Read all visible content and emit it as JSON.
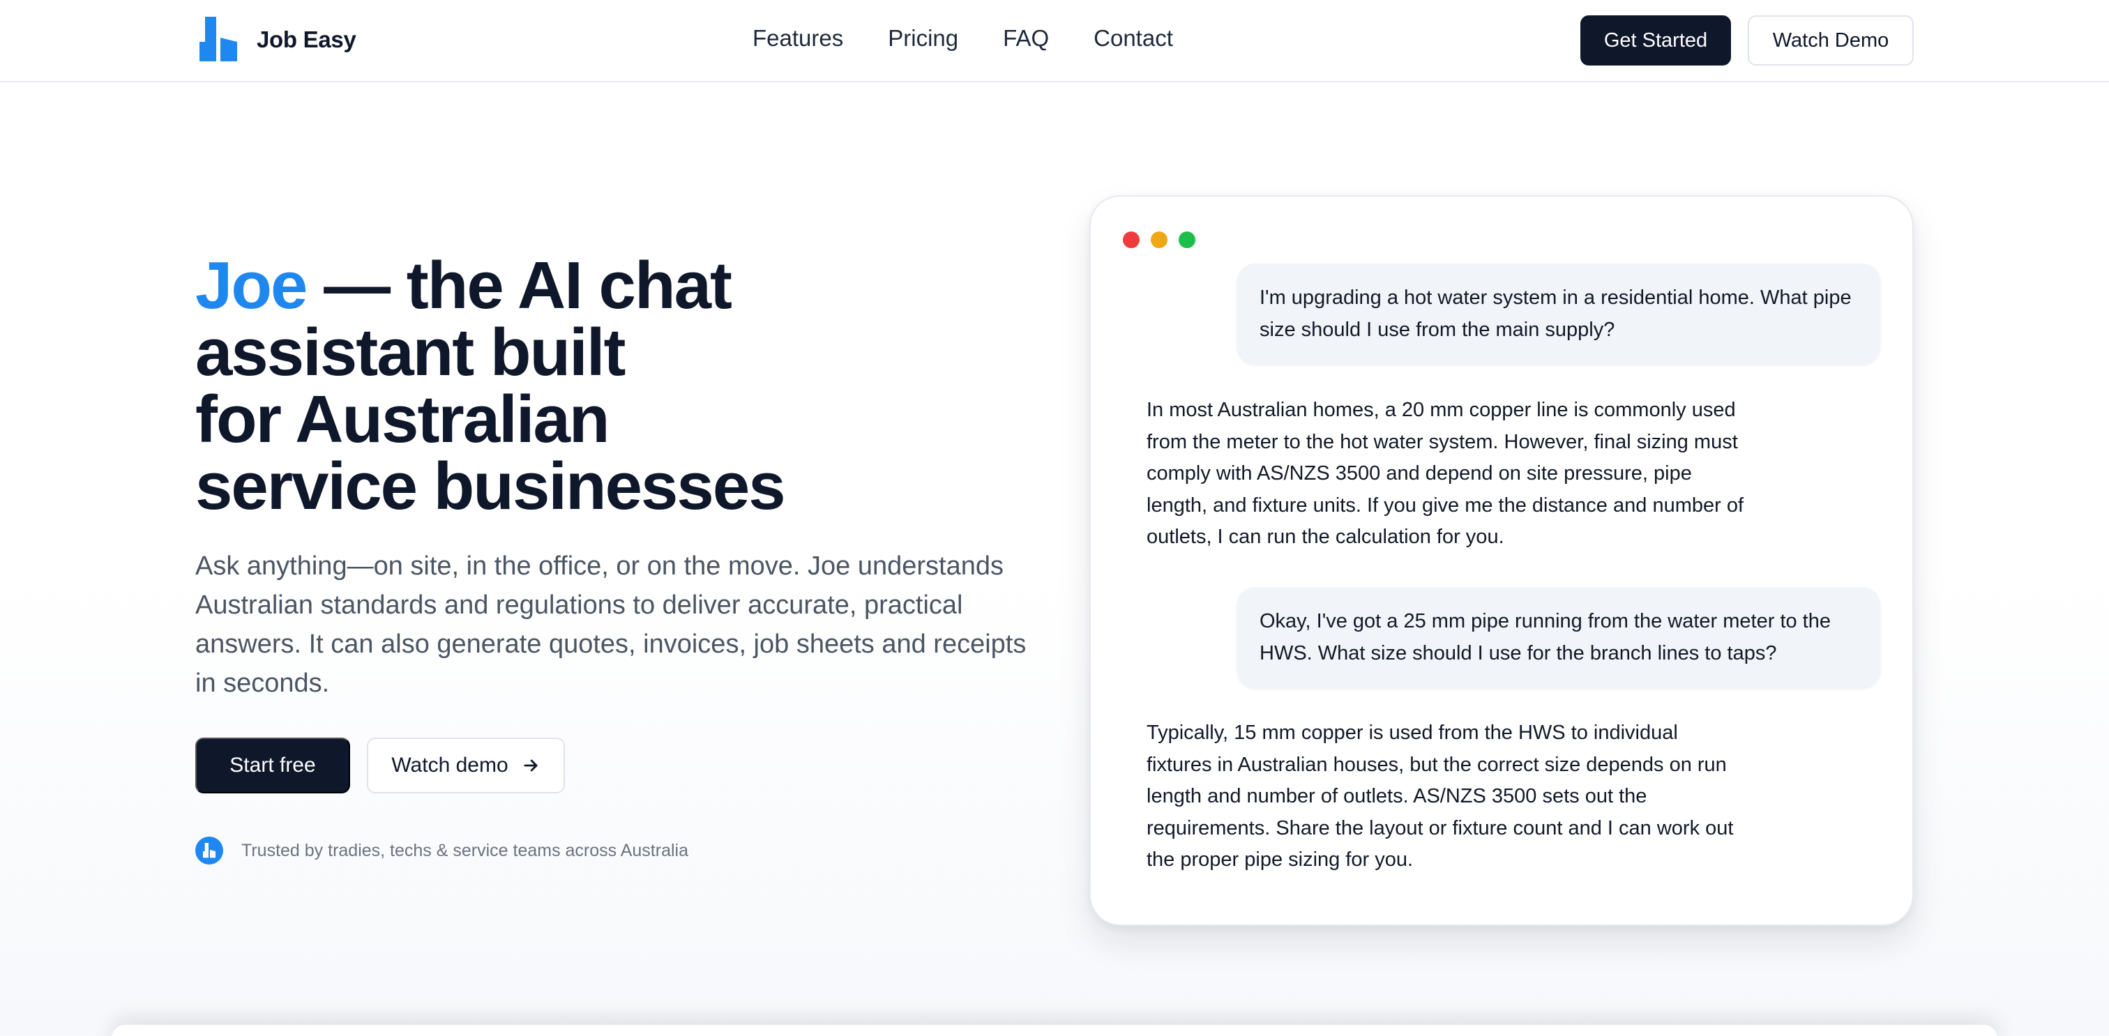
{
  "brand": {
    "name": "Job Easy",
    "accent": "#1e88f0",
    "dark": "#0f172a"
  },
  "nav": {
    "links": [
      "Features",
      "Pricing",
      "FAQ",
      "Contact"
    ],
    "primary_cta": "Get Started",
    "secondary_cta": "Watch Demo"
  },
  "hero": {
    "title_accent": "Joe",
    "title_rest": " — the AI chat",
    "title_line2": "assistant built",
    "title_line3": "for Australian",
    "title_line4": "service businesses",
    "subtitle": "Ask anything—on site, in the office, or on the move. Joe understands Australian standards and regulations to deliver accurate, practical answers. It can also generate quotes, invoices, job sheets and receipts in seconds.",
    "primary_button": "Start free",
    "secondary_button": "Watch demo",
    "trust_text": "Trusted by tradies, techs & service teams across Australia"
  },
  "chat": {
    "window_dots": [
      "#ef3b3b",
      "#f0a716",
      "#1dbf4a"
    ],
    "messages": [
      {
        "role": "user",
        "text": "I'm upgrading a hot water system in a residential home. What pipe size should I use from the main supply?"
      },
      {
        "role": "assistant",
        "text": "In most Australian homes, a 20 mm copper line is commonly used from the meter to the hot water system. However, final sizing must comply with AS/NZS 3500 and depend on site pressure, pipe length, and fixture units. If you give me the distance and number of outlets, I can run the calculation for you."
      },
      {
        "role": "user",
        "text": "Okay, I've got a 25 mm pipe running from the water meter to the HWS. What size should I use for the branch lines to taps?"
      },
      {
        "role": "assistant",
        "text": "Typically, 15 mm copper is used from the HWS to individual fixtures in Australian houses, but the correct size depends on run length and number of outlets. AS/NZS 3500 sets out the requirements. Share the layout or fixture count and I can work out the proper pipe sizing for you."
      }
    ]
  }
}
